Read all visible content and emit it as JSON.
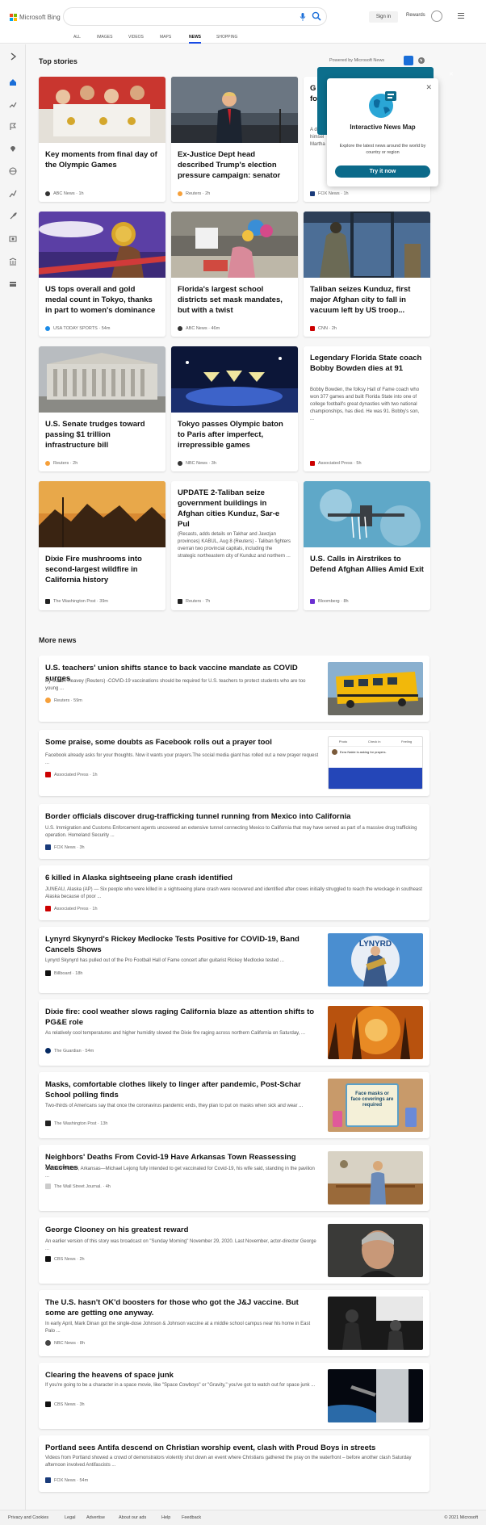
{
  "header": {
    "logo_text": "Microsoft Bing",
    "signin": "Sign in",
    "rewards": "Rewards",
    "logo_colors": [
      "#f25022",
      "#7fba00",
      "#00a4ef",
      "#ffb900"
    ]
  },
  "nav": [
    "ALL",
    "IMAGES",
    "VIDEOS",
    "MAPS",
    "NEWS",
    "SHOPPING"
  ],
  "nav_active": "NEWS",
  "top_stories": {
    "title": "Top stories",
    "powered_by": "Powered by Microsoft News"
  },
  "cards": [
    {
      "title": "Key moments from final day of the Olympic Games",
      "source": "ABC News",
      "age": "1h"
    },
    {
      "title": "Ex-Justice Dept head described Trump's election pressure campaign: senator",
      "source": "Reuters",
      "age": "2h"
    },
    {
      "title": "G de fo",
      "snippet": "A delete himsel Martha",
      "source": "FOX News",
      "age": "1h"
    },
    {
      "title": "US tops overall and gold medal count in Tokyo, thanks in part to women's dominance",
      "source": "USA TODAY SPORTS",
      "age": "54m"
    },
    {
      "title": "Florida's largest school districts set mask mandates, but with a twist",
      "source": "ABC News",
      "age": "46m"
    },
    {
      "title": "Taliban seizes Kunduz, first major Afghan city to fall in vacuum left by US troop...",
      "source": "CNN",
      "age": "2h"
    },
    {
      "title": "U.S. Senate trudges toward passing $1 trillion infrastructure bill",
      "source": "Reuters",
      "age": "2h"
    },
    {
      "title": "Tokyo passes Olympic baton to Paris after imperfect, irrepressible games",
      "source": "NBC News",
      "age": "3h"
    },
    {
      "title": "Legendary Florida State coach Bobby Bowden dies at 91",
      "snippet": "Bobby Bowden, the folksy Hall of Fame coach who won 377 games and built Florida State into one of college football's great dynasties with two national championships, has died. He was 91. Bobby's son, ...",
      "source": "Associated Press",
      "age": "5h"
    },
    {
      "title": "Dixie Fire mushrooms into second-largest wildfire in California history",
      "source": "The Washington Post",
      "age": "39m"
    },
    {
      "title": "UPDATE 2-Taliban seize government buildings in Afghan cities Kunduz, Sar-e Pul",
      "snippet": "(Recasts, adds details on Takhar and Jawzjan provinces) KABUL, Aug 8 (Reuters) - Taliban fighters overran two provincial capitals, including the strategic northeastern city of Kunduz and northern ...",
      "source": "Reuters",
      "age": "7h"
    },
    {
      "title": "U.S. Calls in Airstrikes to Defend Afghan Allies Amid Exit",
      "source": "Bloomberg",
      "age": "8h"
    }
  ],
  "popup": {
    "title": "Interactive News Map",
    "desc": "Explore the latest news around the world by country or region",
    "button": "Try it now"
  },
  "more_news": {
    "title": "More news"
  },
  "more": [
    {
      "title": "U.S. teachers' union shifts stance to back vaccine mandate as COVID surges",
      "snippet": "By Susan Heavey (Reuters) -COVID-19 vaccinations should be required for U.S. teachers to protect students who are too young ...",
      "source": "Reuters",
      "age": "59m"
    },
    {
      "title": "Some praise, some doubts as Facebook rolls out a prayer tool",
      "snippet": "Facebook already asks for your thoughts. Now it wants your prayers.The social media giant has rolled out a new prayer request ...",
      "source": "Associated Press",
      "age": "1h",
      "fb": {
        "photo": "Photo",
        "check": "Check in",
        "feeling": "Feeling",
        "post": "Ezra Nakie is asking for prayers."
      }
    },
    {
      "title": "Border officials discover drug-trafficking tunnel running from Mexico into California",
      "snippet": "U.S. Immigration and Customs Enforcement agents uncovered an extensive tunnel connecting Mexico to California that may have served as part of a massive drug trafficking operation.  Homeland Security ...",
      "source": "FOX News",
      "age": "3h"
    },
    {
      "title": "6 killed in Alaska sightseeing plane crash identified",
      "snippet": "JUNEAU, Alaska (AP) — Six people who were killed in a sightseeing plane crash were recovered and identified after crews initially struggled to reach the wreckage in southeast Alaska because of poor ...",
      "source": "Associated Press",
      "age": "1h"
    },
    {
      "title": "Lynyrd Skynyrd's Rickey Medlocke Tests Positive for COVID-19, Band Cancels Shows",
      "snippet": "Lynyrd Skynyrd has pulled out of the Pro Football Hall of Fame concert after guitarist Rickey Medlocke tested ...",
      "source": "Billboard",
      "age": "18h",
      "img_text": "LYNYRD"
    },
    {
      "title": "Dixie fire: cool weather slows raging California blaze as attention shifts to PG&E role",
      "snippet": "As relatively cool temperatures and higher humidity slowed the Dixie fire raging across northern California on Saturday, ...",
      "source": "The Guardian",
      "age": "54m"
    },
    {
      "title": "Masks, comfortable clothes likely to linger after pandemic, Post-Schar School polling finds",
      "snippet": "Two-thirds of Americans say that once the coronavirus pandemic ends, they plan to put on masks when sick and wear ...",
      "source": "The Washington Post",
      "age": "13h",
      "img_text": "Face masks or face coverings are required"
    },
    {
      "title": "Neighbors' Deaths From Covid-19 Have Arkansas Town Reassessing Vaccines",
      "snippet": "GREENWOOD, Arkansas—Michael Lejong fully intended to get vaccinated for Covid-19, his wife said, standing in the pavilion ...",
      "source": "The Wall Street Journal.",
      "age": "4h"
    },
    {
      "title": "George Clooney on his greatest reward",
      "snippet": "An earlier version of this story was broadcast on \"Sunday Morning\" November 29, 2020. Last November, actor-director George ...",
      "source": "CBS News",
      "age": "2h"
    },
    {
      "title": "The U.S. hasn't OK'd boosters for those who got the J&J vaccine. But some are getting one anyway.",
      "snippet": "In early April, Mark Dinan got the single-dose Johnson & Johnson vaccine at a middle school campus near his home in East Palo ...",
      "source": "NBC News",
      "age": "8h"
    },
    {
      "title": "Clearing the heavens of space junk",
      "snippet": "If you're going to be a character in a space movie, like \"Space Cowboys\" or \"Gravity,\" you've got to watch out for space junk ...",
      "source": "CBS News",
      "age": "3h"
    },
    {
      "title": "Portland sees Antifa descend on Christian worship event, clash with Proud Boys in streets",
      "snippet": "Videos from Portland showed a crowd of demonstrators violently shut down an event where Christians gathered the pray on the waterfront – before another clash Saturday afternoon involved Antifascists ...",
      "source": "FOX News",
      "age": "54m"
    }
  ],
  "footer": {
    "links": [
      "Privacy and Cookies",
      "Legal",
      "Advertise",
      "About our ads",
      "Help",
      "Feedback"
    ],
    "copyright": "© 2021 Microsoft"
  }
}
